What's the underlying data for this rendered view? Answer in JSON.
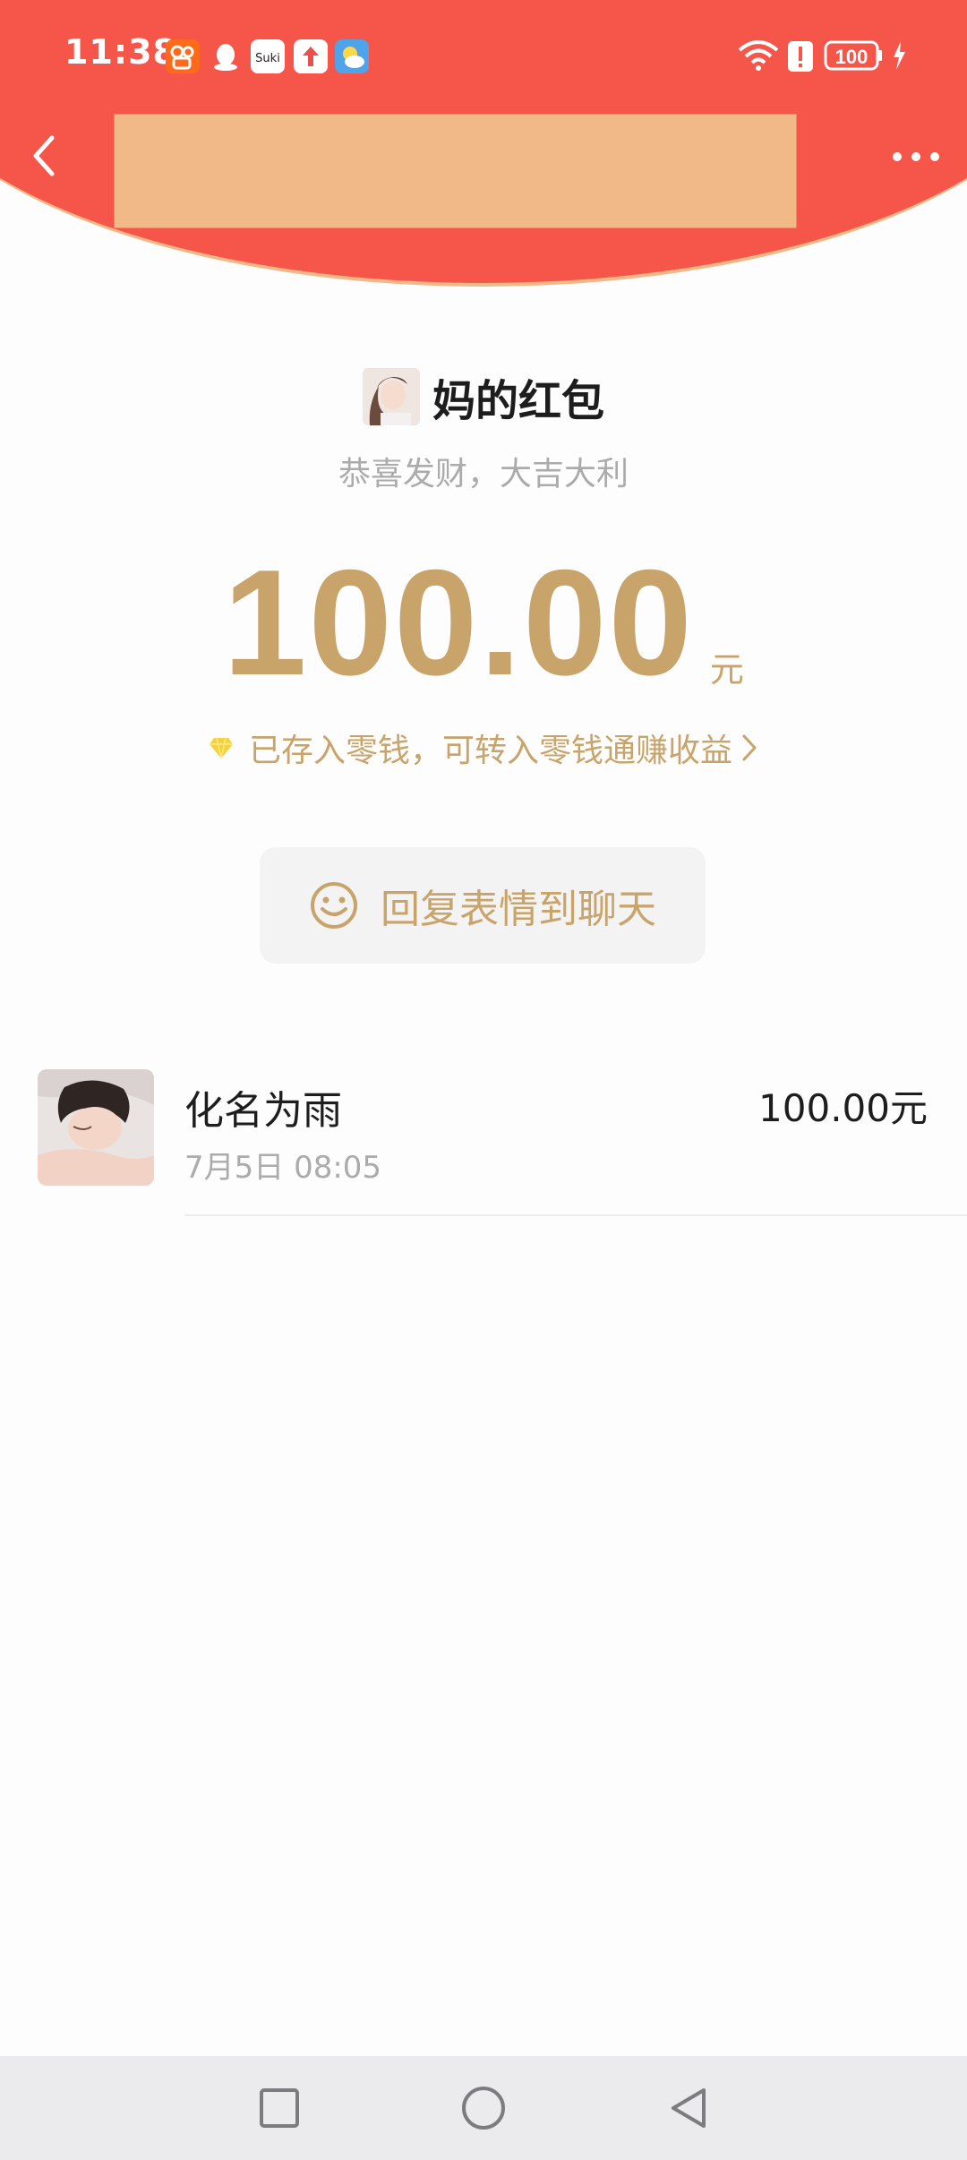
{
  "status_bar": {
    "time": "11:38",
    "app_icons": [
      "kuaishou-icon",
      "qq-icon",
      "suki-icon",
      "upload-icon",
      "weather-icon"
    ],
    "suki_label": "Suki",
    "battery": "100"
  },
  "nav": {
    "back_icon": "chevron-left-icon",
    "more_icon": "more-horizontal-icon"
  },
  "sender": {
    "title": "妈的红包",
    "greeting": "恭喜发财，大吉大利"
  },
  "amount": {
    "value": "100.00",
    "unit": "元"
  },
  "saved_notice": {
    "text": "已存入零钱，可转入零钱通赚收益",
    "icon": "diamond-icon"
  },
  "reply_button": {
    "label": "回复表情到聊天",
    "icon": "smiley-icon"
  },
  "receivers": [
    {
      "name": "化名为雨",
      "time": "7月5日  08:05",
      "amount": "100.00元"
    }
  ],
  "colors": {
    "header_red": "#f6564a",
    "header_edge": "#f1b888",
    "gold": "#c8a46b",
    "text_dark": "#1d1d1d",
    "text_gray": "#ababab",
    "nav_bar": "#ebeaed"
  }
}
